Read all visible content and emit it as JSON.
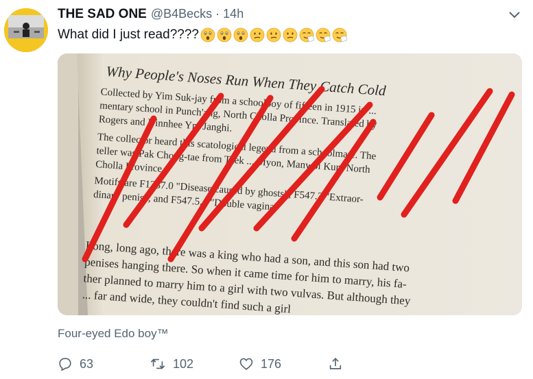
{
  "tweet": {
    "display_name": "THE SAD ONE",
    "handle": "@B4Becks",
    "separator": "·",
    "time": "14h",
    "text": "What did I just read????",
    "caption": "Four-eyed Edo boy™"
  },
  "emojis": [
    "astonished-face",
    "astonished-face",
    "astonished-face",
    "confused-face",
    "confused-face",
    "confused-face",
    "sneezing-face",
    "sneezing-face",
    "sneezing-face"
  ],
  "book_page": {
    "title": "Why People's Noses Run When They Catch Cold",
    "lines": [
      "Collected by Yim Suk-jay from a schoolboy of fifteen in 1915 in ...",
      "mentary school in Punch'ang, North Cholla Province. Translated by",
      "Rogers and Dinnhee Ym Janghi.",
      "The collector heard this scatological legend from a schoolmate. The",
      "teller was Pak Chong-tae from Taek ... Myon, Manwol Kun, North",
      "Cholla Province.",
      "Motifs are F1337.0 \"Disease caused by ghosts\"; F547.3 \"Extraor-",
      "dinary penis\"; and F547.5.4 \"Double vagina.\"",
      "Long, long ago, there was a king who had a son, and this son had two",
      "penises hanging there. So when it came time for him to marry, his fa-",
      "ther planned to marry him to a girl with two vulvas. But although they",
      "... far and wide, they couldn't find such a girl"
    ]
  },
  "actions": {
    "replies": "63",
    "retweets": "102",
    "likes": "176"
  },
  "colors": {
    "scribble": "#e0211d",
    "muted": "#536471",
    "avatar_bg": "#f3c623"
  }
}
